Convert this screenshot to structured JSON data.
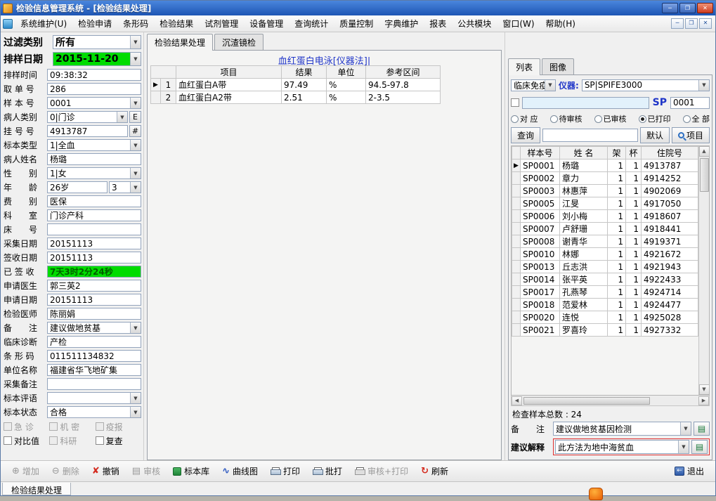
{
  "window": {
    "title": "检验信息管理系统 - [检验结果处理]"
  },
  "menu": {
    "items": [
      "系统维护(U)",
      "检验申请",
      "条形码",
      "检验结果",
      "试剂管理",
      "设备管理",
      "查询统计",
      "质量控制",
      "字典维护",
      "报表",
      "公共模块",
      "窗口(W)",
      "帮助(H)"
    ]
  },
  "left_panel": {
    "filter": {
      "label": "过滤类别",
      "value": "所有"
    },
    "sample_date": {
      "label": "排样日期",
      "value": "2015-11-20"
    },
    "fields": [
      {
        "label": "排样时间",
        "value": "09:38:32",
        "type": "text"
      },
      {
        "label": "取 单 号",
        "value": "286",
        "type": "text"
      },
      {
        "label": "样 本 号",
        "value": "0001",
        "type": "combo"
      },
      {
        "label": "病人类别",
        "value": "0|门诊",
        "type": "combo",
        "extra": "E"
      },
      {
        "label": "挂 号 号",
        "value": "4913787",
        "type": "text",
        "extra": "#"
      },
      {
        "label": "标本类型",
        "value": "1|全血",
        "type": "combo"
      },
      {
        "label": "病人姓名",
        "value": "杨璐",
        "type": "text"
      },
      {
        "label": "性　　别",
        "value": "1|女",
        "type": "combo"
      },
      {
        "label": "年　　龄",
        "value": "26岁",
        "value2": "3",
        "type": "age"
      },
      {
        "label": "费　　别",
        "value": "医保",
        "type": "text"
      },
      {
        "label": "科　　室",
        "value": "门诊产科",
        "type": "text"
      },
      {
        "label": "床　　号",
        "value": "",
        "type": "text"
      },
      {
        "label": "采集日期",
        "value": "20151113",
        "type": "text"
      },
      {
        "label": "签收日期",
        "value": "20151113",
        "type": "text"
      },
      {
        "label": "已 签 收",
        "value": "7天3时2分24秒",
        "type": "text",
        "green": true
      },
      {
        "label": "申请医生",
        "value": "郭三英2",
        "type": "text"
      },
      {
        "label": "申请日期",
        "value": "20151113",
        "type": "text"
      },
      {
        "label": "检验医师",
        "value": "陈丽娟",
        "type": "text"
      },
      {
        "label": "备　　注",
        "value": "建议做地贫基",
        "type": "combo"
      },
      {
        "label": "临床诊断",
        "value": "产检",
        "type": "text"
      },
      {
        "label": "条 形 码",
        "value": "011511134832",
        "type": "text"
      },
      {
        "label": "单位名称",
        "value": "福建省华飞地矿集",
        "type": "text"
      },
      {
        "label": "采集备注",
        "value": "",
        "type": "text"
      },
      {
        "label": "标本评语",
        "value": "",
        "type": "combo"
      },
      {
        "label": "标本状态",
        "value": "合格",
        "type": "combo"
      }
    ],
    "checkbox_rows": [
      [
        {
          "label": "急 诊",
          "disabled": true
        },
        {
          "label": "机 密",
          "disabled": true
        },
        {
          "label": "疫报",
          "disabled": true
        }
      ],
      [
        {
          "label": "对比值",
          "disabled": false
        },
        {
          "label": "科研",
          "disabled": true
        },
        {
          "label": "复查",
          "disabled": false
        }
      ]
    ]
  },
  "main": {
    "tabs": [
      {
        "label": "检验结果处理"
      },
      {
        "label": "沉渣镜检"
      }
    ],
    "result_title": "血红蛋白电泳[仪器法]|",
    "table": {
      "headers": [
        "项目",
        "结果",
        "单位",
        "参考区间"
      ],
      "rows": [
        {
          "num": "1",
          "item": "血红蛋白A带",
          "result": "97.49",
          "unit": "%",
          "range": "94.5-97.8",
          "selected": true
        },
        {
          "num": "2",
          "item": "血红蛋白A2带",
          "result": "2.51",
          "unit": "%",
          "range": "2-3.5",
          "selected": false
        }
      ]
    }
  },
  "right_panel": {
    "tabs": [
      {
        "label": "列表"
      },
      {
        "label": "图像"
      }
    ],
    "dept_combo": "临床免疫",
    "instrument_label": "仪器:",
    "instrument_combo": "SP|SPIFE3000",
    "sp_filter_value": "",
    "sp_label": "SP",
    "sp_value": "0001",
    "radios": [
      {
        "label": "对 应",
        "selected": false
      },
      {
        "label": "待审核",
        "selected": false
      },
      {
        "label": "已审核",
        "selected": false
      },
      {
        "label": "已打印",
        "selected": true
      },
      {
        "label": "全 部",
        "selected": false
      }
    ],
    "query_button": "查询",
    "query_input": "",
    "default_button": "默认",
    "project_button": "项目",
    "sample_table": {
      "headers": [
        "样本号",
        "姓 名",
        "架",
        "杯",
        "住院号"
      ],
      "rows": [
        {
          "id": "SP0001",
          "name": "杨璐",
          "rack": "1",
          "cup": "1",
          "admission": "4913787",
          "selected": true
        },
        {
          "id": "SP0002",
          "name": "章力",
          "rack": "1",
          "cup": "1",
          "admission": "4914252",
          "selected": false
        },
        {
          "id": "SP0003",
          "name": "林惠萍",
          "rack": "1",
          "cup": "1",
          "admission": "4902069",
          "selected": false
        },
        {
          "id": "SP0005",
          "name": "江旻",
          "rack": "1",
          "cup": "1",
          "admission": "4917050",
          "selected": false
        },
        {
          "id": "SP0006",
          "name": "刘小梅",
          "rack": "1",
          "cup": "1",
          "admission": "4918607",
          "selected": false
        },
        {
          "id": "SP0007",
          "name": "卢舒珊",
          "rack": "1",
          "cup": "1",
          "admission": "4918441",
          "selected": false
        },
        {
          "id": "SP0008",
          "name": "谢青华",
          "rack": "1",
          "cup": "1",
          "admission": "4919371",
          "selected": false
        },
        {
          "id": "SP0010",
          "name": "林娜",
          "rack": "1",
          "cup": "1",
          "admission": "4921672",
          "selected": false
        },
        {
          "id": "SP0013",
          "name": "丘志洪",
          "rack": "1",
          "cup": "1",
          "admission": "4921943",
          "selected": false
        },
        {
          "id": "SP0014",
          "name": "张平英",
          "rack": "1",
          "cup": "1",
          "admission": "4922433",
          "selected": false
        },
        {
          "id": "SP0017",
          "name": "孔燕琴",
          "rack": "1",
          "cup": "1",
          "admission": "4924714",
          "selected": false
        },
        {
          "id": "SP0018",
          "name": "范爱林",
          "rack": "1",
          "cup": "1",
          "admission": "4924477",
          "selected": false
        },
        {
          "id": "SP0020",
          "name": "连悦",
          "rack": "1",
          "cup": "1",
          "admission": "4925028",
          "selected": false
        },
        {
          "id": "SP0021",
          "name": "罗喜玲",
          "rack": "1",
          "cup": "1",
          "admission": "4927332",
          "selected": false
        }
      ]
    },
    "total_text": "检查样本总数 : 24",
    "remark": {
      "label": "备　　注",
      "value": "建议做地贫基因检测"
    },
    "advice": {
      "label": "建议解释",
      "value": "此方法为地中海贫血"
    }
  },
  "toolbar": {
    "buttons": [
      {
        "name": "add-button",
        "label": "增加",
        "icon": "plus-circle",
        "disabled": true
      },
      {
        "name": "delete-button",
        "label": "删除",
        "icon": "minus-circle",
        "disabled": true
      },
      {
        "name": "undo-button",
        "label": "撤销",
        "icon": "cancel",
        "disabled": false
      },
      {
        "name": "audit-button",
        "label": "审核",
        "icon": "audit",
        "disabled": true
      },
      {
        "name": "specimen-library-button",
        "label": "标本库",
        "icon": "specimen-library",
        "disabled": false
      },
      {
        "name": "curve-chart-button",
        "label": "曲线图",
        "icon": "curve-chart",
        "disabled": false
      },
      {
        "name": "print-button",
        "label": "打印",
        "icon": "printer",
        "disabled": false
      },
      {
        "name": "batch-print-button",
        "label": "批打",
        "icon": "printer",
        "disabled": false
      },
      {
        "name": "audit-print-button",
        "label": "审核+打印",
        "icon": "audit-printer",
        "disabled": true
      },
      {
        "name": "refresh-button",
        "label": "刷新",
        "icon": "refresh",
        "disabled": false
      }
    ],
    "exit_label": "退出"
  },
  "statusbar": {
    "tab": "检验结果处理"
  }
}
